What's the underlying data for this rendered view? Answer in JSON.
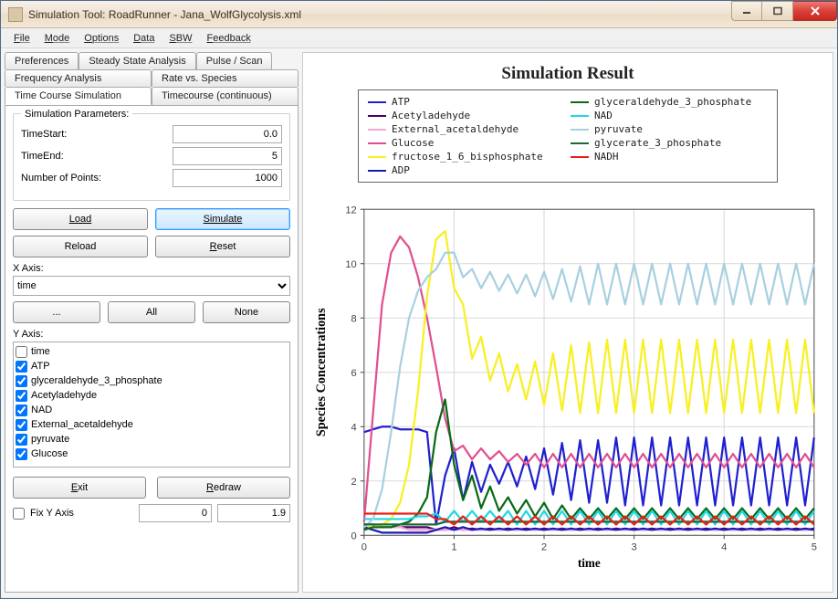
{
  "window": {
    "title": "Simulation Tool: RoadRunner - Jana_WolfGlycolysis.xml"
  },
  "menu": [
    "File",
    "Mode",
    "Options",
    "Data",
    "SBW",
    "Feedback"
  ],
  "tabs": {
    "row1": [
      "Preferences",
      "Steady State Analysis",
      "Pulse / Scan"
    ],
    "row2": [
      "Frequency Analysis",
      "Rate vs. Species"
    ],
    "row3": [
      "Time Course Simulation",
      "Timecourse (continuous)"
    ],
    "active": "Time Course Simulation"
  },
  "params": {
    "group_title": "Simulation Parameters:",
    "fields": {
      "TimeStart": "0.0",
      "TimeEnd": "5",
      "NumberOfPoints": "1000"
    },
    "labels": {
      "TimeStart": "TimeStart:",
      "TimeEnd": "TimeEnd:",
      "NumberOfPoints": "Number of Points:"
    }
  },
  "buttons": {
    "load": "Load",
    "simulate": "Simulate",
    "reload": "Reload",
    "reset": "Reset",
    "dots": "...",
    "all": "All",
    "none": "None",
    "exit": "Exit",
    "redraw": "Redraw"
  },
  "xaxis": {
    "label": "X Axis:",
    "value": "time"
  },
  "yaxis": {
    "label": "Y Axis:",
    "items": [
      {
        "label": "time",
        "checked": false
      },
      {
        "label": "ATP",
        "checked": true
      },
      {
        "label": "glyceraldehyde_3_phosphate",
        "checked": true
      },
      {
        "label": "Acetyladehyde",
        "checked": true
      },
      {
        "label": "NAD",
        "checked": true
      },
      {
        "label": "External_acetaldehyde",
        "checked": true
      },
      {
        "label": "pyruvate",
        "checked": true
      },
      {
        "label": "Glucose",
        "checked": true
      }
    ]
  },
  "fixy": {
    "label": "Fix Y Axis",
    "checked": false,
    "min": "0",
    "max": "1.9"
  },
  "chart_data": {
    "type": "line",
    "title": "Simulation Result",
    "xlabel": "time",
    "ylabel": "Species Concentrations",
    "xlim": [
      0,
      5
    ],
    "ylim": [
      0,
      12
    ],
    "xticks": [
      0,
      1,
      2,
      3,
      4,
      5
    ],
    "yticks": [
      0,
      2,
      4,
      6,
      8,
      10,
      12
    ],
    "series": [
      {
        "name": "ATP",
        "color": "#2020d0",
        "values": [
          3.8,
          3.9,
          4.0,
          4.0,
          3.9,
          3.9,
          3.9,
          3.8,
          0.4,
          2.2,
          3.2,
          1.3,
          2.7,
          1.6,
          2.6,
          1.9,
          2.7,
          1.8,
          2.9,
          1.7,
          3.2,
          1.5,
          3.4,
          1.3,
          3.5,
          1.2,
          3.5,
          1.2,
          3.6,
          1.1,
          3.6,
          1.1,
          3.6,
          1.1,
          3.6,
          1.1,
          3.6,
          1.1,
          3.6,
          1.1,
          3.6,
          1.1,
          3.6,
          1.1,
          3.6,
          1.1,
          3.6,
          1.1,
          3.6,
          1.1,
          3.6
        ]
      },
      {
        "name": "Acetyladehyde",
        "color": "#4b0060",
        "values": [
          0.4,
          0.4,
          0.3,
          0.3,
          0.3,
          0.3,
          0.3,
          0.3,
          0.2,
          0.2,
          0.3,
          0.2,
          0.25,
          0.2,
          0.25,
          0.2,
          0.25,
          0.2,
          0.25,
          0.2,
          0.25,
          0.2,
          0.25,
          0.2,
          0.25,
          0.2,
          0.25,
          0.2,
          0.25,
          0.2,
          0.25,
          0.2,
          0.25,
          0.2,
          0.25,
          0.2,
          0.25,
          0.2,
          0.25,
          0.2,
          0.25,
          0.2,
          0.25,
          0.2,
          0.25,
          0.2,
          0.25,
          0.2,
          0.25,
          0.2,
          0.25
        ]
      },
      {
        "name": "External_acetaldehyde",
        "color": "#f4a8d8",
        "values": [
          0.3,
          0.3,
          0.3,
          0.3,
          0.3,
          0.2,
          0.2,
          0.2,
          0.2,
          0.2,
          0.2,
          0.2,
          0.2,
          0.2,
          0.2,
          0.2,
          0.2,
          0.2,
          0.2,
          0.2,
          0.2,
          0.2,
          0.2,
          0.2,
          0.2,
          0.2,
          0.2,
          0.2,
          0.2,
          0.2,
          0.2,
          0.2,
          0.2,
          0.2,
          0.2,
          0.2,
          0.2,
          0.2,
          0.2,
          0.2,
          0.2,
          0.2,
          0.2,
          0.2,
          0.2,
          0.2,
          0.2,
          0.2,
          0.2,
          0.2,
          0.2
        ]
      },
      {
        "name": "Glucose",
        "color": "#e05090",
        "values": [
          0.5,
          4.5,
          8.5,
          10.4,
          11.0,
          10.6,
          9.5,
          8.0,
          6.2,
          4.3,
          3.1,
          3.3,
          2.8,
          3.2,
          2.8,
          3.1,
          2.7,
          3.0,
          2.6,
          3.0,
          2.5,
          3.0,
          2.5,
          3.0,
          2.5,
          3.0,
          2.5,
          3.0,
          2.5,
          3.0,
          2.5,
          3.0,
          2.5,
          3.0,
          2.5,
          3.0,
          2.5,
          3.0,
          2.5,
          3.0,
          2.5,
          3.0,
          2.5,
          3.0,
          2.5,
          3.0,
          2.5,
          3.0,
          2.5,
          3.0,
          2.5
        ]
      },
      {
        "name": "fructose_1_6_bisphosphate",
        "color": "#f8f020",
        "values": [
          0.3,
          0.3,
          0.4,
          0.6,
          1.2,
          2.6,
          5.3,
          8.8,
          10.9,
          11.2,
          9.1,
          8.5,
          6.5,
          7.3,
          5.7,
          6.7,
          5.3,
          6.3,
          5.0,
          6.4,
          4.8,
          6.7,
          4.6,
          7.0,
          4.5,
          7.1,
          4.5,
          7.2,
          4.5,
          7.2,
          4.5,
          7.2,
          4.5,
          7.2,
          4.5,
          7.2,
          4.5,
          7.2,
          4.5,
          7.2,
          4.5,
          7.2,
          4.5,
          7.2,
          4.5,
          7.2,
          4.5,
          7.2,
          4.5,
          7.2,
          4.5
        ]
      },
      {
        "name": "ADP",
        "color": "#1818b8",
        "values": [
          0.3,
          0.2,
          0.1,
          0.1,
          0.1,
          0.1,
          0.1,
          0.1,
          0.2,
          0.3,
          0.2,
          0.3,
          0.2,
          0.25,
          0.2,
          0.25,
          0.2,
          0.25,
          0.2,
          0.25,
          0.2,
          0.25,
          0.2,
          0.25,
          0.2,
          0.25,
          0.2,
          0.25,
          0.2,
          0.25,
          0.2,
          0.25,
          0.2,
          0.25,
          0.2,
          0.25,
          0.2,
          0.25,
          0.2,
          0.25,
          0.2,
          0.25,
          0.2,
          0.25,
          0.2,
          0.25,
          0.2,
          0.25,
          0.2,
          0.25,
          0.2
        ]
      },
      {
        "name": "glyceraldehyde_3_phosphate",
        "color": "#0a6a18",
        "values": [
          0.2,
          0.3,
          0.3,
          0.3,
          0.4,
          0.5,
          0.8,
          1.4,
          3.8,
          5.0,
          2.6,
          1.3,
          2.2,
          1.0,
          1.8,
          0.9,
          1.4,
          0.8,
          1.3,
          0.7,
          1.2,
          0.6,
          1.1,
          0.6,
          1.0,
          0.6,
          1.0,
          0.6,
          1.0,
          0.6,
          1.0,
          0.6,
          1.0,
          0.6,
          1.0,
          0.6,
          1.0,
          0.6,
          1.0,
          0.6,
          1.0,
          0.6,
          1.0,
          0.6,
          1.0,
          0.6,
          1.0,
          0.6,
          1.0,
          0.6,
          1.0
        ]
      },
      {
        "name": "NAD",
        "color": "#20d8e8",
        "values": [
          0.6,
          0.6,
          0.6,
          0.6,
          0.6,
          0.6,
          0.7,
          0.7,
          0.8,
          0.5,
          0.9,
          0.5,
          0.9,
          0.5,
          0.9,
          0.5,
          0.9,
          0.4,
          0.9,
          0.4,
          0.9,
          0.4,
          0.9,
          0.4,
          0.9,
          0.4,
          0.9,
          0.4,
          0.9,
          0.4,
          0.9,
          0.4,
          0.9,
          0.4,
          0.9,
          0.4,
          0.9,
          0.4,
          0.9,
          0.4,
          0.9,
          0.4,
          0.9,
          0.4,
          0.9,
          0.4,
          0.9,
          0.4,
          0.9,
          0.4,
          0.9
        ]
      },
      {
        "name": "pyruvate",
        "color": "#a8d0e0",
        "values": [
          0.3,
          0.6,
          1.7,
          3.8,
          6.2,
          8.0,
          9.0,
          9.5,
          9.8,
          10.4,
          10.4,
          9.5,
          9.8,
          9.1,
          9.7,
          9.0,
          9.6,
          8.9,
          9.6,
          8.8,
          9.7,
          8.7,
          9.8,
          8.6,
          9.9,
          8.5,
          10.0,
          8.5,
          10.0,
          8.5,
          10.0,
          8.5,
          10.0,
          8.5,
          10.0,
          8.5,
          10.0,
          8.5,
          10.0,
          8.5,
          10.0,
          8.5,
          10.0,
          8.5,
          10.0,
          8.5,
          10.0,
          8.5,
          10.0,
          8.5,
          10.0
        ]
      },
      {
        "name": "glycerate_3_phosphate",
        "color": "#1b6838",
        "values": [
          0.4,
          0.4,
          0.4,
          0.4,
          0.4,
          0.4,
          0.4,
          0.4,
          0.4,
          0.5,
          0.5,
          0.5,
          0.5,
          0.5,
          0.5,
          0.5,
          0.5,
          0.5,
          0.5,
          0.5,
          0.5,
          0.5,
          0.5,
          0.5,
          0.5,
          0.5,
          0.5,
          0.5,
          0.5,
          0.5,
          0.5,
          0.5,
          0.5,
          0.5,
          0.5,
          0.5,
          0.5,
          0.5,
          0.5,
          0.5,
          0.5,
          0.5,
          0.5,
          0.5,
          0.5,
          0.5,
          0.5,
          0.5,
          0.5,
          0.5,
          0.5
        ]
      },
      {
        "name": "NADH",
        "color": "#e82018",
        "values": [
          0.8,
          0.8,
          0.8,
          0.8,
          0.8,
          0.8,
          0.8,
          0.8,
          0.6,
          0.6,
          0.4,
          0.7,
          0.4,
          0.7,
          0.4,
          0.7,
          0.4,
          0.7,
          0.4,
          0.7,
          0.4,
          0.7,
          0.4,
          0.7,
          0.4,
          0.7,
          0.4,
          0.7,
          0.4,
          0.7,
          0.4,
          0.7,
          0.4,
          0.7,
          0.4,
          0.7,
          0.4,
          0.7,
          0.4,
          0.7,
          0.4,
          0.7,
          0.4,
          0.7,
          0.4,
          0.7,
          0.4,
          0.7,
          0.4,
          0.7,
          0.4
        ]
      }
    ]
  }
}
